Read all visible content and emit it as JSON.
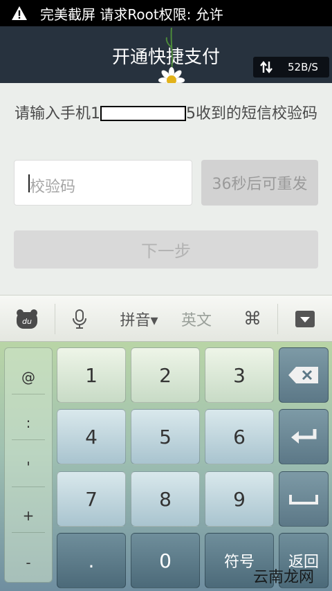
{
  "status_bar": {
    "message": "完美截屏 请求Root权限: 允许"
  },
  "header": {
    "title": "开通快捷支付",
    "net_rate": "52B/S"
  },
  "form": {
    "prompt_before": "请输入手机1",
    "prompt_after": "5收到的短信校验码",
    "code_placeholder": "校验码",
    "resend_label": "36秒后可重发",
    "next_label": "下一步"
  },
  "ime_bar": {
    "pinyin_label": "拼音▾",
    "english_label": "英文"
  },
  "keyboard": {
    "symbols": [
      "@",
      ":",
      "'",
      "+",
      "-"
    ],
    "keys": [
      "1",
      "2",
      "3",
      "4",
      "5",
      "6",
      "7",
      "8",
      "9",
      ".",
      "0"
    ],
    "symbol_key_label": "符号",
    "return_key_label": "返回"
  },
  "watermark": {
    "text": "云南龙网"
  },
  "colors": {
    "header_bg": "#27323e",
    "content_bg": "#ebeeeb",
    "keyboard_top": "#b9d5a6",
    "keyboard_bottom": "#6f8ea0"
  }
}
